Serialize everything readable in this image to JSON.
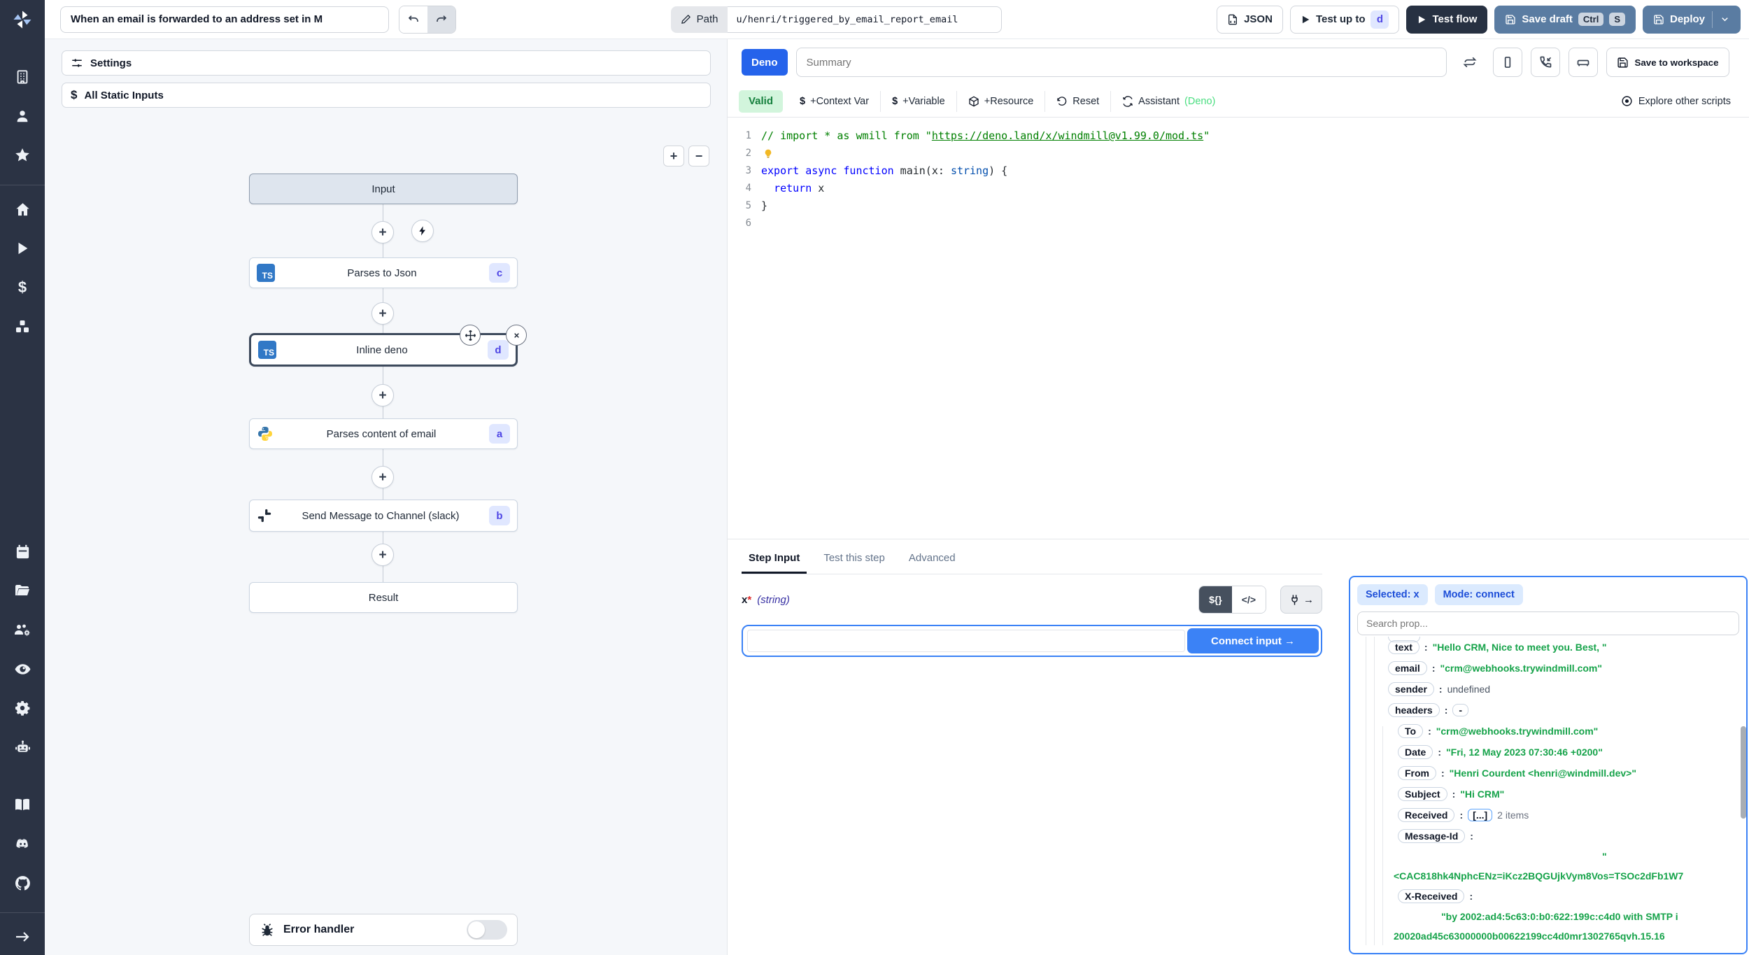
{
  "topbar": {
    "title_value": "When an email is forwarded to an address set in M",
    "path_label": "Path",
    "path_value": "u/henri/triggered_by_email_report_email",
    "json_button_label": "JSON",
    "test_up_to_label": "Test up to",
    "test_up_to_step": "d",
    "test_flow_label": "Test flow",
    "save_draft_label": "Save draft",
    "save_draft_kbd": [
      "Ctrl",
      "S"
    ],
    "deploy_label": "Deploy"
  },
  "sidebar": {
    "icons": [
      "windmill-logo",
      "building",
      "user",
      "star",
      "home",
      "play",
      "dollar",
      "cubes",
      "calendar",
      "folder-open",
      "user-group-gear",
      "eye",
      "gear",
      "robot",
      "book-open",
      "discord",
      "github",
      "arrow-right"
    ]
  },
  "flow": {
    "settings_label": "Settings",
    "static_inputs_label": "All Static Inputs",
    "zoom_in": "+",
    "zoom_out": "−",
    "input_label": "Input",
    "result_label": "Result",
    "error_handler_label": "Error handler",
    "nodes": [
      {
        "label": "Parses to Json",
        "badge": "c",
        "lang": "typescript",
        "selected": false
      },
      {
        "label": "Inline deno",
        "badge": "d",
        "lang": "typescript",
        "selected": true
      },
      {
        "label": "Parses content of email",
        "badge": "a",
        "lang": "python",
        "selected": false
      },
      {
        "label": "Send Message to Channel (slack)",
        "badge": "b",
        "lang": "slack",
        "selected": false
      }
    ]
  },
  "editor": {
    "lang_badge": "Deno",
    "summary_placeholder": "Summary",
    "save_to_workspace_label": "Save to workspace",
    "validity": "Valid",
    "toolbar": {
      "context_var": "+Context Var",
      "variable": "+Variable",
      "resource": "+Resource",
      "reset": "Reset",
      "assistant": "Assistant",
      "assistant_mode": "(Deno)",
      "explore": "Explore other scripts"
    },
    "code": {
      "line_numbers": [
        "1",
        "2",
        "3",
        "4",
        "5",
        "6"
      ],
      "lines": [
        {
          "bulb": false,
          "tokens": [
            {
              "text": "// import * as wmill from \"",
              "cls": "cmt"
            },
            {
              "text": "https://deno.land/x/windmill@v1.99.0/mod.ts",
              "cls": "cmt-link"
            },
            {
              "text": "\"",
              "cls": "cmt"
            }
          ]
        },
        {
          "bulb": true,
          "tokens": []
        },
        {
          "bulb": false,
          "tokens": [
            {
              "text": "export",
              "cls": "kw"
            },
            {
              "text": " ",
              "cls": "pln"
            },
            {
              "text": "async",
              "cls": "kw"
            },
            {
              "text": " ",
              "cls": "pln"
            },
            {
              "text": "function",
              "cls": "kw"
            },
            {
              "text": " main(x",
              "cls": "pln"
            },
            {
              "text": ": ",
              "cls": "pln"
            },
            {
              "text": "string",
              "cls": "typ"
            },
            {
              "text": ") {",
              "cls": "pln"
            }
          ]
        },
        {
          "bulb": false,
          "tokens": [
            {
              "text": "  ",
              "cls": "pln"
            },
            {
              "text": "return",
              "cls": "kw"
            },
            {
              "text": " x",
              "cls": "pln"
            }
          ]
        },
        {
          "bulb": false,
          "tokens": [
            {
              "text": "}",
              "cls": "pln"
            }
          ]
        },
        {
          "bulb": false,
          "tokens": []
        }
      ]
    }
  },
  "step_panel": {
    "tabs": [
      {
        "label": "Step Input"
      },
      {
        "label": "Test this step"
      },
      {
        "label": "Advanced"
      }
    ],
    "field_name": "x",
    "field_required": "*",
    "field_type": "(string)",
    "toggle_template": "${}",
    "toggle_code": "</>",
    "connect_button_label": "Connect input →",
    "input_value": ""
  },
  "connect_panel": {
    "selected_badge": "Selected: x",
    "mode_badge": "Mode: connect",
    "search_placeholder": "Search prop...",
    "tree": [
      {
        "key": "text",
        "value": "\"Hello CRM, Nice to meet you. Best, \"",
        "type": "string",
        "indent": 0
      },
      {
        "key": "email",
        "value": "\"crm@webhooks.trywindmill.com\"",
        "type": "string",
        "indent": 0
      },
      {
        "key": "sender",
        "value": "undefined",
        "type": "undefined",
        "indent": 0
      },
      {
        "key": "headers",
        "value": "-",
        "type": "collapse",
        "indent": 0
      },
      {
        "key": "To",
        "value": "\"crm@webhooks.trywindmill.com\"",
        "type": "string",
        "indent": 1
      },
      {
        "key": "Date",
        "value": "\"Fri, 12 May 2023 07:30:46 +0200\"",
        "type": "string",
        "indent": 1
      },
      {
        "key": "From",
        "value": "\"Henri Courdent <henri@windmill.dev>\"",
        "type": "string",
        "indent": 1
      },
      {
        "key": "Subject",
        "value": "\"Hi CRM\"",
        "type": "string",
        "indent": 1
      },
      {
        "key": "Received",
        "value": "[...]",
        "type": "array",
        "suffix": "2 items",
        "indent": 1
      },
      {
        "key": "Message-Id",
        "type": "multiline",
        "indent": 1,
        "value_lines": [
          {
            "text": "\"",
            "pad": 350
          },
          {
            "text": "<CAC818hk4NphcENz=iKcz2BQGUjkVym8Vos=TSOc2dFb1W7",
            "pad": 52
          }
        ]
      },
      {
        "key": "X-Received",
        "type": "multiline",
        "indent": 1,
        "value_lines": [
          {
            "text": "\"by 2002:ad4:5c63:0:b0:622:199c:c4d0 with SMTP i",
            "pad": 120
          },
          {
            "text": "20020ad45c63000000b00622199cc4d0mr1302765qvh.15.16",
            "pad": 52
          }
        ]
      }
    ]
  },
  "colors": {
    "accent_blue": "#3b82f6",
    "steel_blue": "#5a7ca2",
    "dark_navy": "#273142",
    "sidebar_bg": "#2b3344",
    "badge_indigo_bg": "#e0e7ff",
    "badge_indigo_text": "#4f46e5",
    "valid_green_bg": "#d2f5dc",
    "valid_green_text": "#15803d",
    "tree_string_green": "#16a34a",
    "ts_blue": "#3178c6",
    "deno_badge_blue": "#2563eb",
    "connect_badge_bg": "#dbeafe",
    "connect_badge_text": "#1d4ed8"
  }
}
